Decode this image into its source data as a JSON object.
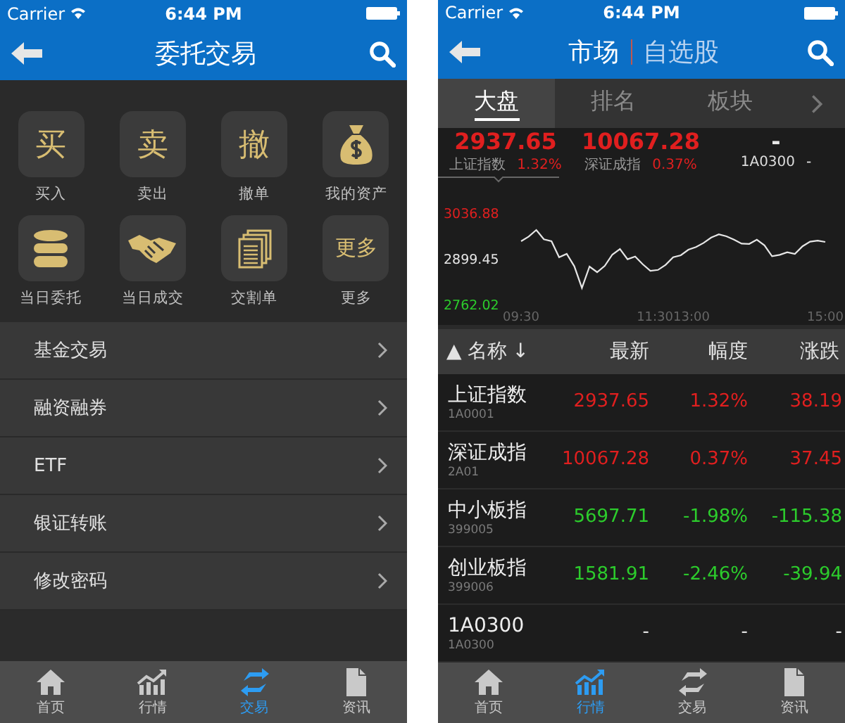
{
  "trade_screen": {
    "status_bar": {
      "carrier": "Carrier",
      "time": "6:44 PM"
    },
    "title": "委托交易",
    "actions": [
      {
        "kind": "glyph",
        "glyph": "买",
        "label": "买入"
      },
      {
        "kind": "glyph",
        "glyph": "卖",
        "label": "卖出"
      },
      {
        "kind": "glyph",
        "glyph": "撤",
        "label": "撤单"
      },
      {
        "kind": "bag",
        "label": "我的资产"
      },
      {
        "kind": "stack",
        "label": "当日委托"
      },
      {
        "kind": "handshake",
        "label": "当日成交"
      },
      {
        "kind": "papers",
        "label": "交割单"
      },
      {
        "kind": "glyph",
        "glyph": "更多",
        "label": "更多"
      }
    ],
    "menu": [
      {
        "label": "基金交易"
      },
      {
        "label": "融资融券"
      },
      {
        "label": "ETF"
      },
      {
        "label": "银证转账"
      },
      {
        "label": "修改密码"
      }
    ],
    "tab_bar": [
      {
        "label": "首页",
        "selected": false
      },
      {
        "label": "行情",
        "selected": false
      },
      {
        "label": "交易",
        "selected": true
      },
      {
        "label": "资讯",
        "selected": false
      }
    ]
  },
  "market_screen": {
    "status_bar": {
      "carrier": "Carrier",
      "time": "6:44 PM"
    },
    "title_segments": [
      {
        "label": "市场",
        "selected": true
      },
      {
        "label": "自选股",
        "selected": false
      }
    ],
    "tabs": [
      {
        "label": "大盘",
        "selected": true
      },
      {
        "label": "排名",
        "selected": false
      },
      {
        "label": "板块",
        "selected": false
      }
    ],
    "indices": [
      {
        "value": "2937.65",
        "name": "上证指数",
        "change": "1.32%",
        "color": "#e01f1f",
        "selected": true
      },
      {
        "value": "10067.28",
        "name": "深证成指",
        "change": "0.37%",
        "color": "#e01f1f",
        "selected": false
      },
      {
        "value": "-",
        "name": "1A0300",
        "change": "-",
        "color": "#e8e8e8",
        "selected": false
      }
    ],
    "chart": {
      "chart_data": {
        "type": "line",
        "categories": [
          "09:30",
          null,
          null,
          null,
          null,
          null,
          null,
          null,
          null,
          null,
          null,
          null,
          null,
          null,
          null,
          null,
          null,
          null,
          null,
          null,
          "11:3013:00",
          null,
          null,
          null,
          null,
          null,
          null,
          null,
          null,
          null,
          null,
          null,
          null,
          null,
          null,
          null,
          null,
          null,
          null,
          null,
          "15:00"
        ],
        "series": [
          {
            "color": "#e6e6e6",
            "values": [
              2950,
              2964,
              2984,
              2956,
              2950,
              2902,
              2912,
              2875,
              2810,
              2874,
              2857,
              2876,
              2910,
              2927,
              2896,
              2904,
              2881,
              2861,
              2864,
              2879,
              2902,
              2908,
              2925,
              2933,
              2945,
              2961,
              2971,
              2965,
              2955,
              2943,
              2942,
              2955,
              2938,
              2905,
              2909,
              2917,
              2912,
              2935,
              2949,
              2952,
              2948
            ]
          }
        ],
        "ylim": [
          2762.02,
          3036.88
        ],
        "yticks": [
          {
            "value": 3036.88,
            "label": "3036.88"
          },
          {
            "value": 2899.45,
            "label": "2899.45"
          },
          {
            "value": 2762.02,
            "label": "2762.02"
          }
        ]
      }
    },
    "table": {
      "sort_toggle": "▲",
      "columns": [
        {
          "label": "名称",
          "sort_mark": "↓"
        },
        {
          "label": "最新"
        },
        {
          "label": "幅度"
        },
        {
          "label": "涨跌"
        }
      ],
      "rows": [
        {
          "name": "上证指数",
          "code": "1A0001",
          "latest": "2937.65",
          "change_pct": "1.32%",
          "change": "38.19",
          "color": "#e01f1f"
        },
        {
          "name": "深证成指",
          "code": "2A01",
          "latest": "10067.28",
          "change_pct": "0.37%",
          "change": "37.45",
          "color": "#e01f1f"
        },
        {
          "name": "中小板指",
          "code": "399005",
          "latest": "5697.71",
          "change_pct": "-1.98%",
          "change": "-115.38",
          "color": "#2ccc2c"
        },
        {
          "name": "创业板指",
          "code": "399006",
          "latest": "1581.91",
          "change_pct": "-2.46%",
          "change": "-39.94",
          "color": "#2ccc2c"
        },
        {
          "name": "1A0300",
          "code": "1A0300",
          "latest": "-",
          "change_pct": "-",
          "change": "-",
          "color": "#e8e8e8"
        }
      ]
    },
    "tab_bar": [
      {
        "label": "首页",
        "selected": false
      },
      {
        "label": "行情",
        "selected": true
      },
      {
        "label": "交易",
        "selected": false
      },
      {
        "label": "资讯",
        "selected": false
      }
    ]
  }
}
